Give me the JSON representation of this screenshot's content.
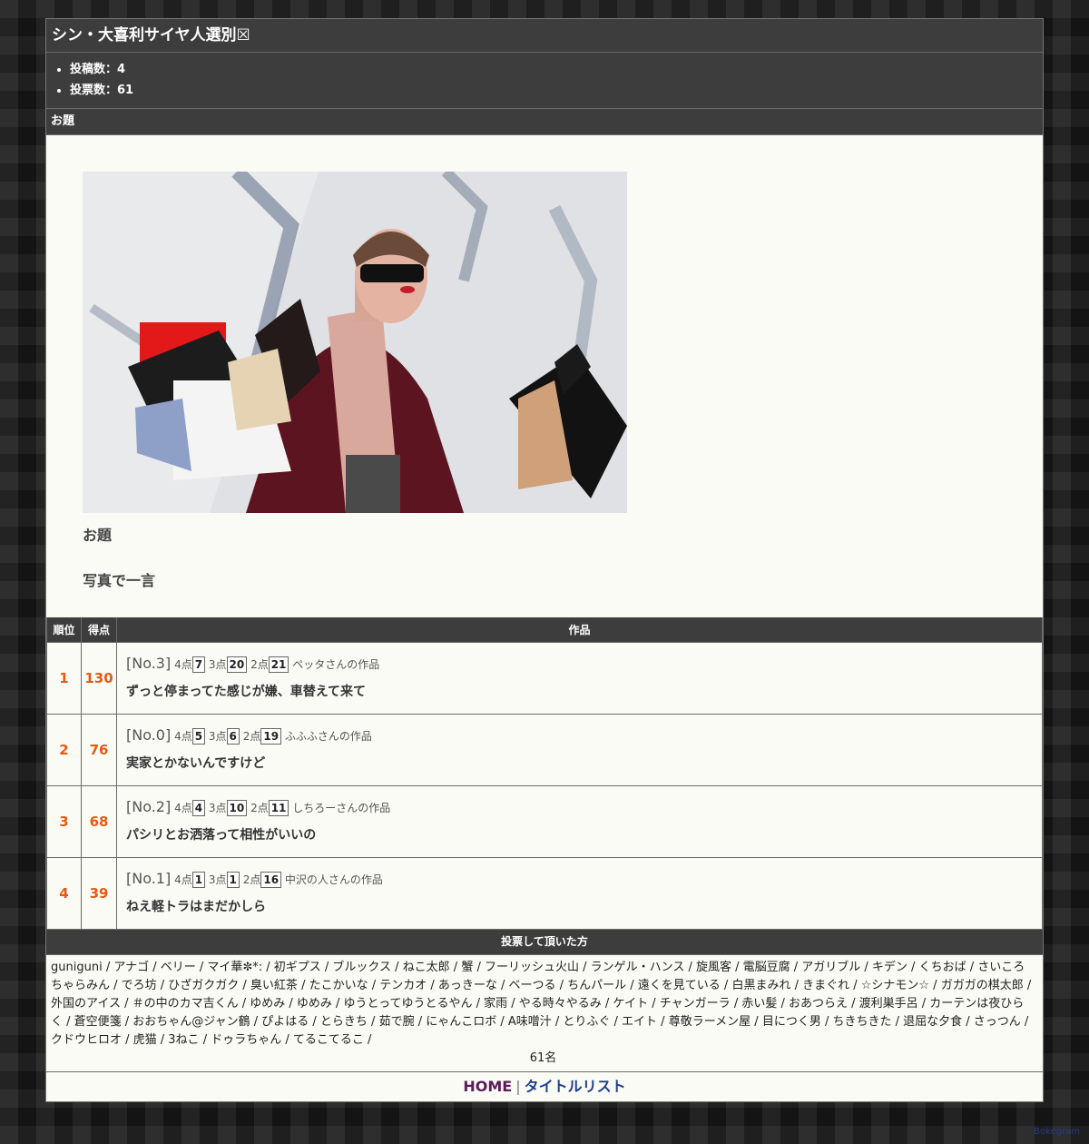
{
  "header": {
    "title": "シン・大喜利サイヤ人選別☒"
  },
  "stats": {
    "posts": "投稿数：4",
    "votes": "投票数：61"
  },
  "odai": {
    "bar_label": "お題",
    "label": "お題",
    "text": "写真で一言"
  },
  "table": {
    "headers": {
      "rank": "順位",
      "score": "得点",
      "work": "作品"
    },
    "rows": [
      {
        "rank": "1",
        "score": "130",
        "no": "[No.3]",
        "p4": "4点",
        "v4": "7",
        "p3": "3点",
        "v3": "20",
        "p2": "2点",
        "v2": "21",
        "author": "ペッタさんの作品",
        "text": "ずっと停まってた感じが嫌、車替えて来て"
      },
      {
        "rank": "2",
        "score": "76",
        "no": "[No.0]",
        "p4": "4点",
        "v4": "5",
        "p3": "3点",
        "v3": "6",
        "p2": "2点",
        "v2": "19",
        "author": "ふふふさんの作品",
        "text": "実家とかないんですけど"
      },
      {
        "rank": "3",
        "score": "68",
        "no": "[No.2]",
        "p4": "4点",
        "v4": "4",
        "p3": "3点",
        "v3": "10",
        "p2": "2点",
        "v2": "11",
        "author": "しちろーさんの作品",
        "text": "パシリとお洒落って相性がいいの"
      },
      {
        "rank": "4",
        "score": "39",
        "no": "[No.1]",
        "p4": "4点",
        "v4": "1",
        "p3": "3点",
        "v3": "1",
        "p2": "2点",
        "v2": "16",
        "author": "中沢の人さんの作品",
        "text": "ねえ軽トラはまだかしら"
      }
    ]
  },
  "voters": {
    "heading": "投票して頂いた方",
    "list": "guniguni / アナゴ / ベリー / マイ華✼*: / 初ギプス / ブルックス / ねこ太郎 / 蟹 / フーリッシュ火山 / ランゲル・ハンス / 旋風客 / 電脳豆腐 / アガリブル / キデン / くちおば / さいころちゃらみん / でろ坊 / ひざガクガク / 臭い紅茶 / たこかいな / テンカオ / あっきーな / ベーつる / ちんパール / 遠くを見ている / 白黒まみれ / きまぐれ / ☆シナモン☆ / ガガガの棋太郎 / 外国のアイス / ＃の中のカマ吉くん / ゆめみ / ゆめみ / ゆうとってゆうとるやん / 家雨 / やる時々やるみ / ケイト / チャンガーラ / 赤い髪 / おあつらえ / 渡利巣手呂 / カーテンは夜ひらく / 蒼空便箋 / おおちゃん@ジャン鶴 / ぴよはる / とらきち / 茹で腕 / にゃんこロボ / A味噌汁 / とりふぐ / エイト / 尊敬ラーメン屋 / 目につく男 / ちきちきた / 退屈な夕食 / さっつん / クドウヒロオ / 虎猫 / 3ねこ / ドゥラちゃん / てるこてるこ /",
    "count": "61名"
  },
  "footer": {
    "home": "HOME",
    "separator": "|",
    "title_list": "タイトルリスト"
  },
  "brand": "Bokegram"
}
